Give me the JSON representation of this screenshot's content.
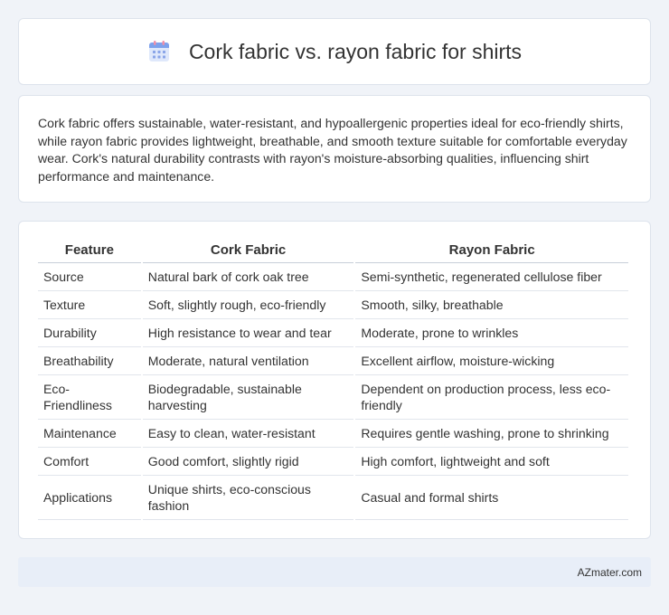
{
  "page": {
    "title": "Cork fabric vs. rayon fabric for shirts",
    "intro": "Cork fabric offers sustainable, water-resistant, and hypoallergenic properties ideal for eco-friendly shirts, while rayon fabric provides lightweight, breathable, and smooth texture suitable for comfortable everyday wear. Cork's natural durability contrasts with rayon's moisture-absorbing qualities, influencing shirt performance and maintenance."
  },
  "table": {
    "headers": [
      "Feature",
      "Cork Fabric",
      "Rayon Fabric"
    ],
    "rows": [
      [
        "Source",
        "Natural bark of cork oak tree",
        "Semi-synthetic, regenerated cellulose fiber"
      ],
      [
        "Texture",
        "Soft, slightly rough, eco-friendly",
        "Smooth, silky, breathable"
      ],
      [
        "Durability",
        "High resistance to wear and tear",
        "Moderate, prone to wrinkles"
      ],
      [
        "Breathability",
        "Moderate, natural ventilation",
        "Excellent airflow, moisture-wicking"
      ],
      [
        "Eco-Friendliness",
        "Biodegradable, sustainable harvesting",
        "Dependent on production process, less eco-friendly"
      ],
      [
        "Maintenance",
        "Easy to clean, water-resistant",
        "Requires gentle washing, prone to shrinking"
      ],
      [
        "Comfort",
        "Good comfort, slightly rigid",
        "High comfort, lightweight and soft"
      ],
      [
        "Applications",
        "Unique shirts, eco-conscious fashion",
        "Casual and formal shirts"
      ]
    ]
  },
  "footer": {
    "site": "AZmater.com"
  },
  "icons": {
    "header_icon": "calendar-icon"
  },
  "colors": {
    "background": "#f0f3f8",
    "icon_blue": "#6a8fe6",
    "icon_pink": "#f08fa8",
    "footer_bg": "#e8eef8"
  }
}
